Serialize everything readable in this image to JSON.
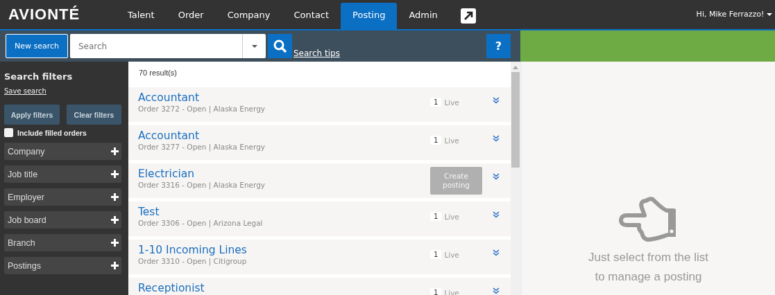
{
  "header": {
    "logo": "AVIONTÉ",
    "nav": [
      {
        "label": "Talent",
        "selected": false
      },
      {
        "label": "Order",
        "selected": false
      },
      {
        "label": "Company",
        "selected": false
      },
      {
        "label": "Contact",
        "selected": false
      },
      {
        "label": "Posting",
        "selected": true
      },
      {
        "label": "Admin",
        "selected": false
      }
    ],
    "user": "Hi, Mike Ferrazzo!"
  },
  "search_bar": {
    "new_search": "New search",
    "placeholder": "Search",
    "tips": "Search tips",
    "help": "?"
  },
  "sidebar": {
    "title": "Search filters",
    "save_search": "Save search",
    "apply": "Apply filters",
    "clear": "Clear filters",
    "include_filled": {
      "label": "Include filled orders",
      "checked": false
    },
    "filters": [
      {
        "label": "Company",
        "expanded": false
      },
      {
        "label": "Job title",
        "expanded": false
      },
      {
        "label": "Employer",
        "expanded": false
      },
      {
        "label": "Job board",
        "expanded": false
      },
      {
        "label": "Branch",
        "expanded": false
      },
      {
        "label": "Postings",
        "expanded": false
      }
    ]
  },
  "results": {
    "count": "70 result(s)",
    "rows": [
      {
        "title": "Accountant",
        "subtitle": "Order 3272 - Open | Alaska Energy",
        "kind": "live",
        "count": "1",
        "status": "Live"
      },
      {
        "title": "Accountant",
        "subtitle": "Order 3277 - Open | Alaska Energy",
        "kind": "live",
        "count": "1",
        "status": "Live"
      },
      {
        "title": "Electrician",
        "subtitle": "Order 3316 - Open | Alaska Energy",
        "kind": "create",
        "action": "Create posting"
      },
      {
        "title": "Test",
        "subtitle": "Order 3306 - Open | Arizona Legal",
        "kind": "live",
        "count": "1",
        "status": "Live"
      },
      {
        "title": "1-10 Incoming Lines",
        "subtitle": "Order 3310 - Open | Citigroup",
        "kind": "live",
        "count": "1",
        "status": "Live"
      },
      {
        "title": "Receptionist",
        "kind": "live",
        "count": "1",
        "status": "Live"
      }
    ]
  },
  "detail": {
    "message": "Just select from the list to manage a posting"
  }
}
